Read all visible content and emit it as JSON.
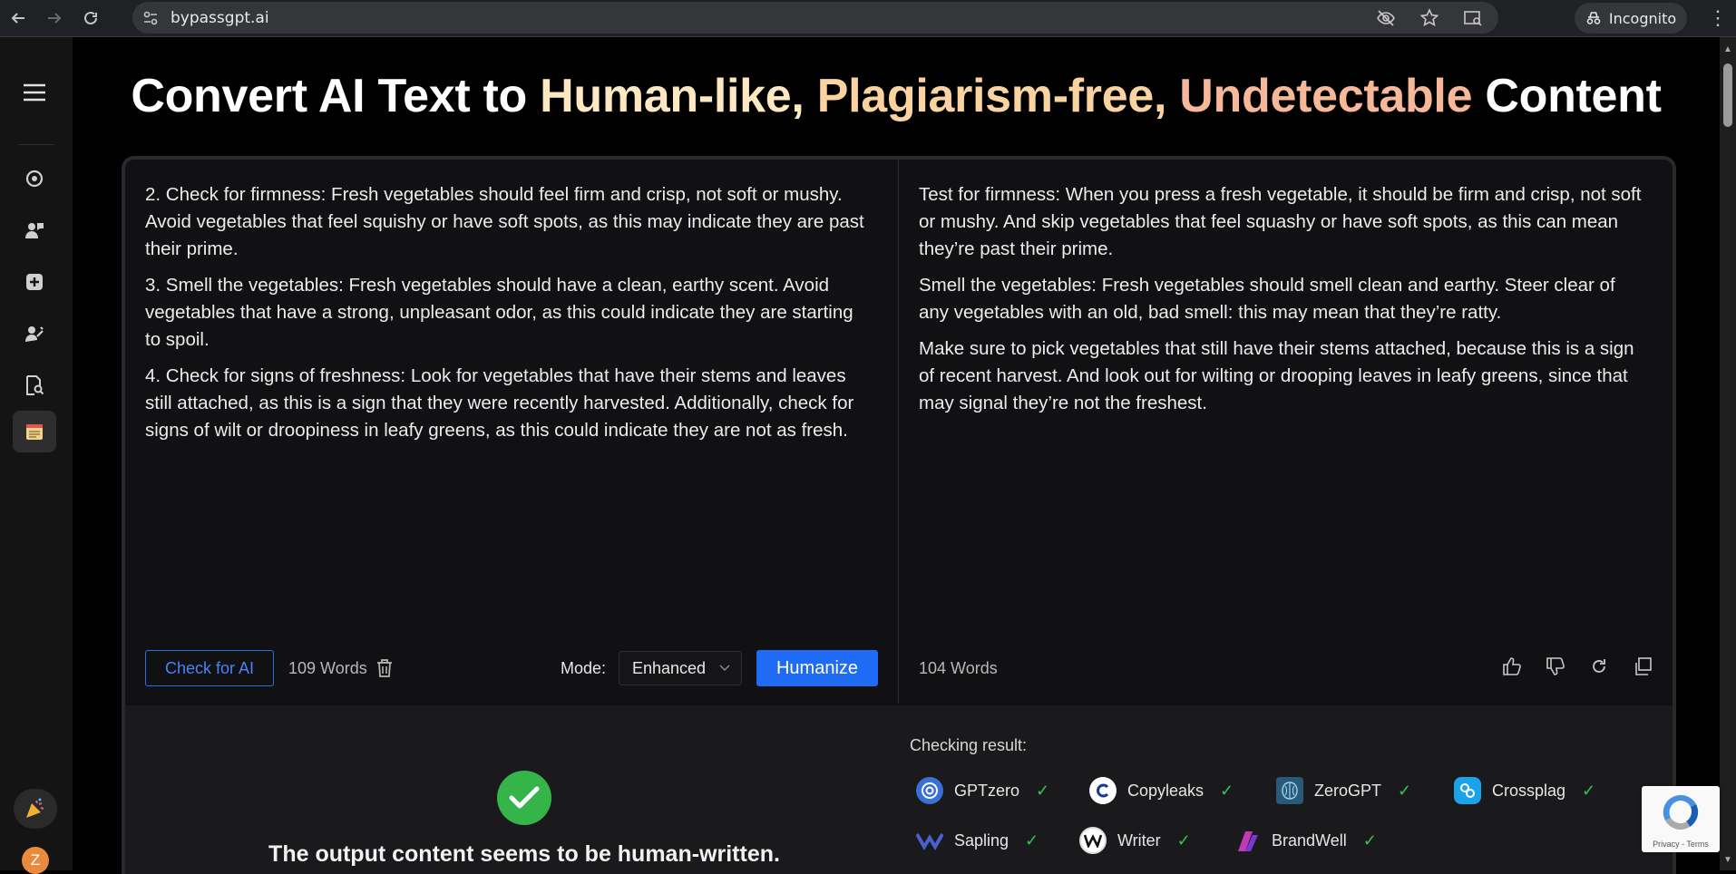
{
  "browser": {
    "url": "bypassgpt.ai",
    "incognito_label": "Incognito"
  },
  "headline": {
    "part1": "Convert AI Text to ",
    "hl1": "Human-like,",
    "hl2": "Plagiarism-free,",
    "hl3": "Undetectable",
    "part_end": "Content"
  },
  "input_pane": {
    "paragraphs": [
      "2. Check for firmness: Fresh vegetables should feel firm and crisp, not soft or mushy. Avoid vegetables that feel squishy or have soft spots, as this may indicate they are past their prime.",
      "3. Smell the vegetables: Fresh vegetables should have a clean, earthy scent. Avoid vegetables that have a strong, unpleasant odor, as this could indicate they are starting to spoil.",
      "4. Check for signs of freshness: Look for vegetables that have their stems and leaves still attached, as this is a sign that they were recently harvested. Additionally, check for signs of wilt or droopiness in leafy greens, as this could indicate they are not as fresh."
    ],
    "check_ai_label": "Check for AI",
    "word_count": "109 Words",
    "mode_label": "Mode:",
    "mode_value": "Enhanced",
    "humanize_label": "Humanize"
  },
  "output_pane": {
    "paragraphs": [
      "Test for firmness: When you press a fresh vegetable, it should be firm and crisp, not soft or mushy. And skip vegetables that feel squashy or have soft spots, as this can mean they’re past their prime.",
      "Smell the vegetables: Fresh vegetables should smell clean and earthy. Steer clear of any vegetables with an old, bad smell: this may mean that they’re ratty.",
      "Make sure to pick vegetables that still have their stems attached, because this is a sign of recent harvest. And look out for wilting or drooping leaves in leafy greens, since that may signal they’re not the freshest."
    ],
    "word_count": "104 Words"
  },
  "result": {
    "message": "The output content seems to be human-written.",
    "checking_label": "Checking result:",
    "detectors": [
      {
        "name": "GPTzero",
        "passed": "✓"
      },
      {
        "name": "Copyleaks",
        "passed": "✓"
      },
      {
        "name": "ZeroGPT",
        "passed": "✓"
      },
      {
        "name": "Crossplag",
        "passed": "✓"
      },
      {
        "name": "Sapling",
        "passed": "✓"
      },
      {
        "name": "Writer",
        "passed": "✓"
      },
      {
        "name": "BrandWell",
        "passed": "✓"
      }
    ]
  },
  "sidebar": {
    "avatar_letter": "Z"
  },
  "recaptcha": {
    "links": "Privacy - Terms"
  },
  "colors": {
    "accent_blue": "#1f6bf5",
    "success_green": "#35b44a",
    "highlight_1": "#fde8c2",
    "highlight_2": "#fbd3a0",
    "highlight_3": "#f7b89a"
  }
}
